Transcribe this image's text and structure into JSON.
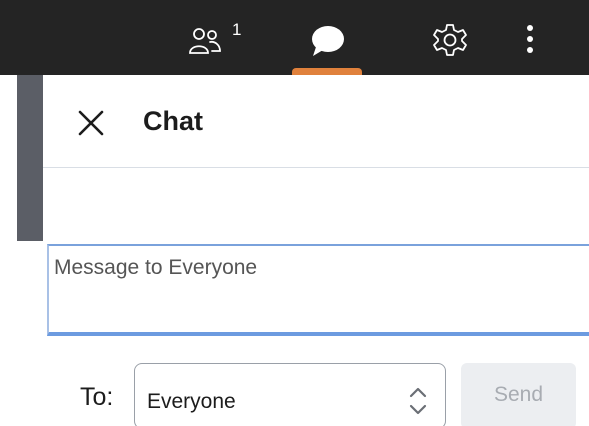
{
  "toolbar": {
    "participants_count": "1",
    "icons": [
      "participants-icon",
      "chat-icon",
      "gear-icon",
      "more-vertical-icon"
    ],
    "active_tab": "chat",
    "accent_color": "#e0813c",
    "background_color": "#242424"
  },
  "chat": {
    "title": "Chat",
    "close_icon": "close-icon",
    "message_placeholder": "Message to Everyone",
    "message_value": ""
  },
  "recipient": {
    "label": "To:",
    "selected": "Everyone",
    "icon": "chevron-updown-icon"
  },
  "send": {
    "label": "Send",
    "enabled": false
  }
}
